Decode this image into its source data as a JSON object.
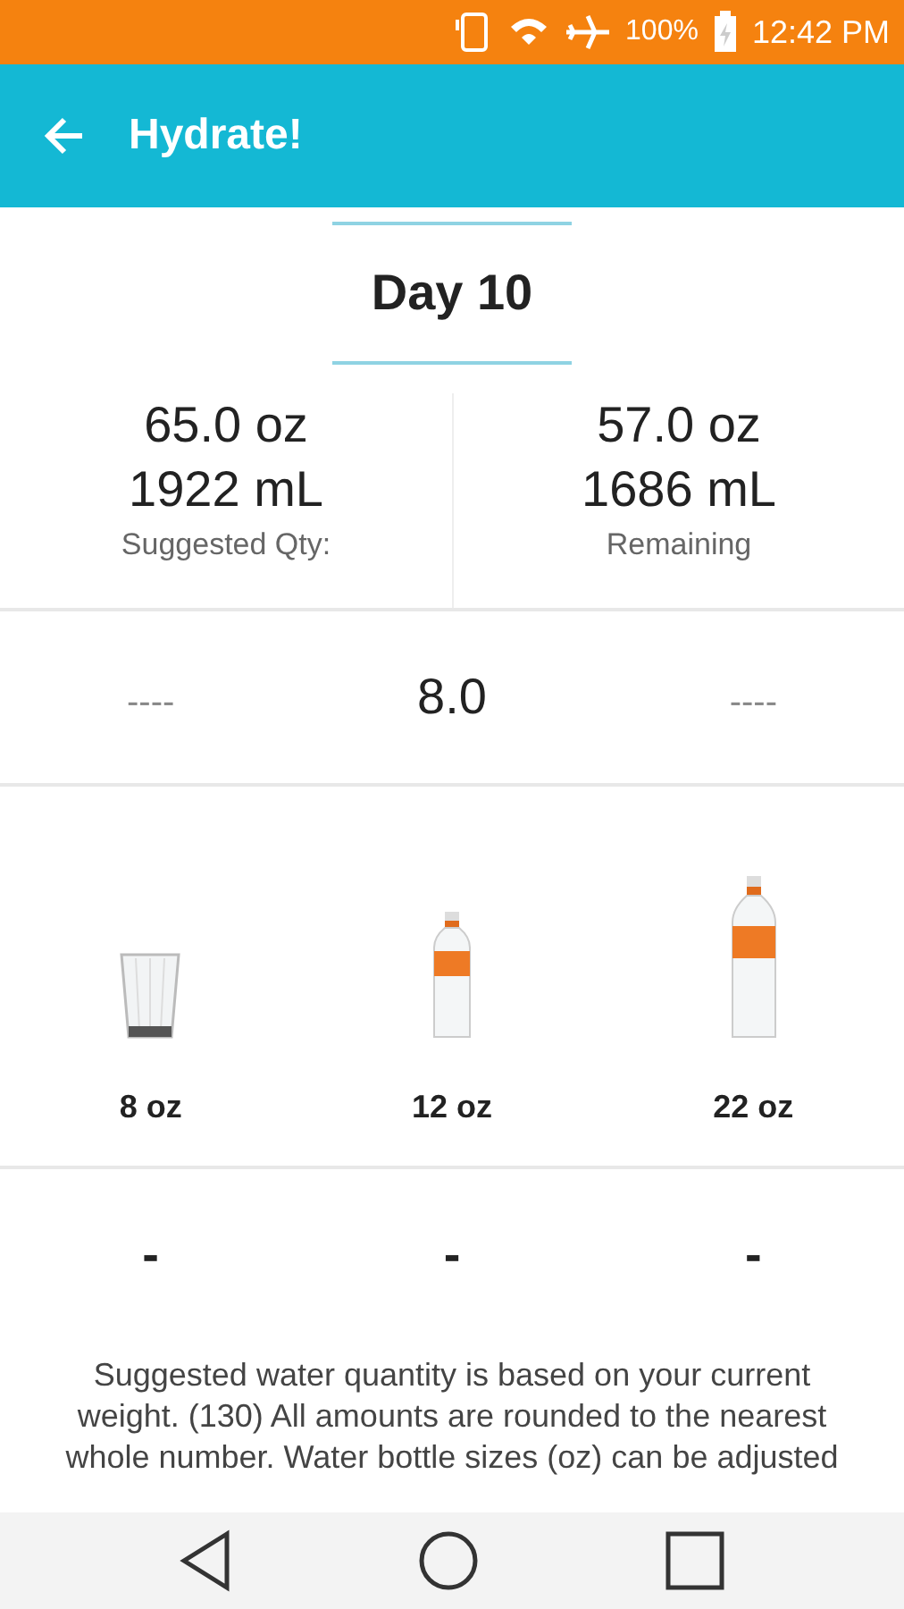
{
  "status_bar": {
    "battery": "100%",
    "time": "12:42 PM"
  },
  "toolbar": {
    "title": "Hydrate!"
  },
  "day": {
    "label": "Day 10"
  },
  "stats": [
    {
      "oz": "65.0 oz",
      "ml": "1922 mL",
      "label": "Suggested Qty:"
    },
    {
      "oz": "57.0 oz",
      "ml": "1686 mL",
      "label": "Remaining"
    }
  ],
  "counter": [
    "----",
    "8.0",
    "----"
  ],
  "containers": [
    {
      "kind": "glass",
      "size": "8 oz"
    },
    {
      "kind": "small-bottle",
      "size": "12 oz"
    },
    {
      "kind": "large-bottle",
      "size": "22 oz"
    }
  ],
  "counts": [
    "-",
    "-",
    "-"
  ],
  "note": "Suggested water quantity is based on your current weight. (130)  All amounts are rounded to the nearest whole number. Water bottle sizes (oz) can be adjusted"
}
